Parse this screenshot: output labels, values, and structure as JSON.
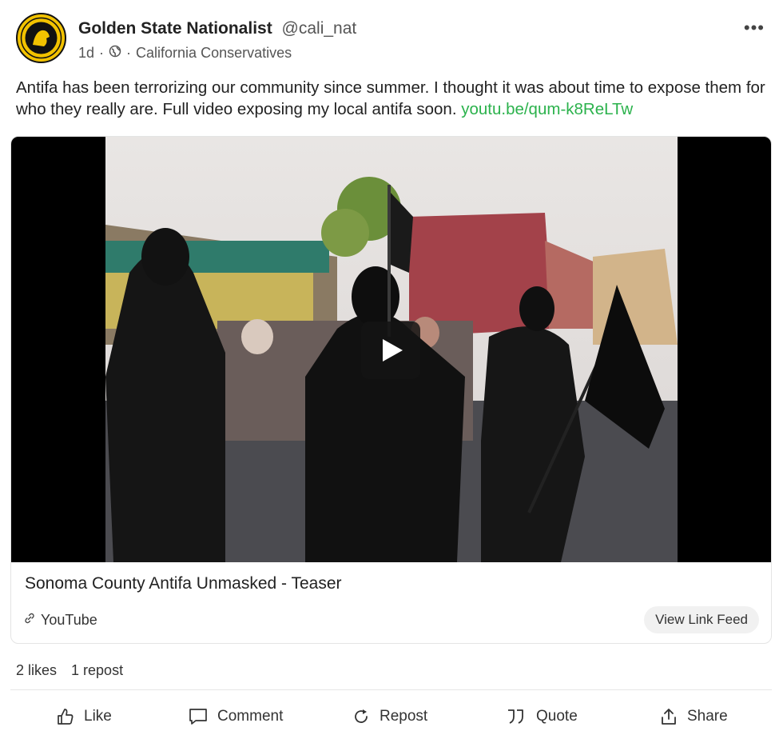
{
  "post": {
    "author_name": "Golden State Nationalist",
    "author_handle": "@cali_nat",
    "age": "1d",
    "separator": "·",
    "community": "California Conservatives",
    "more_label": "•••",
    "text": "Antifa has been terrorizing our community since summer. I thought it was about time to expose them for who they really are. Full video exposing my local antifa soon. ",
    "link_text": "youtu.be/qum-k8ReLTw"
  },
  "card": {
    "title": "Sonoma County Antifa Unmasked - Teaser",
    "source": "YouTube",
    "view_feed_label": "View Link Feed"
  },
  "stats": {
    "likes": "2 likes",
    "reposts": "1 repost"
  },
  "actions": {
    "like": "Like",
    "comment": "Comment",
    "repost": "Repost",
    "quote": "Quote",
    "share": "Share"
  },
  "colors": {
    "link": "#2bb24c",
    "avatar_ring": "#f2c200"
  }
}
